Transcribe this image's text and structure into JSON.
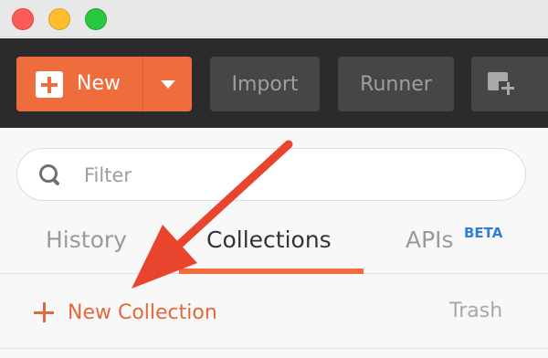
{
  "window": {
    "controls": [
      "close",
      "minimize",
      "maximize"
    ]
  },
  "toolbar": {
    "new_label": "New",
    "new_icon": "plus-square-icon",
    "new_dropdown_icon": "caret-down-icon",
    "import_label": "Import",
    "runner_label": "Runner",
    "new_window_icon": "new-window-icon"
  },
  "search": {
    "placeholder": "Filter",
    "value": ""
  },
  "tabs": [
    {
      "label": "History",
      "active": false
    },
    {
      "label": "Collections",
      "active": true
    },
    {
      "label": "APIs",
      "active": false,
      "badge": "BETA"
    }
  ],
  "actions": {
    "new_collection_label": "New Collection",
    "trash_label": "Trash"
  },
  "annotation": {
    "type": "arrow",
    "color": "#e8442e"
  },
  "colors": {
    "accent": "#ef6c3c",
    "toolbar_bg": "#2b2b2b",
    "beta_badge": "#2f7fd6"
  }
}
